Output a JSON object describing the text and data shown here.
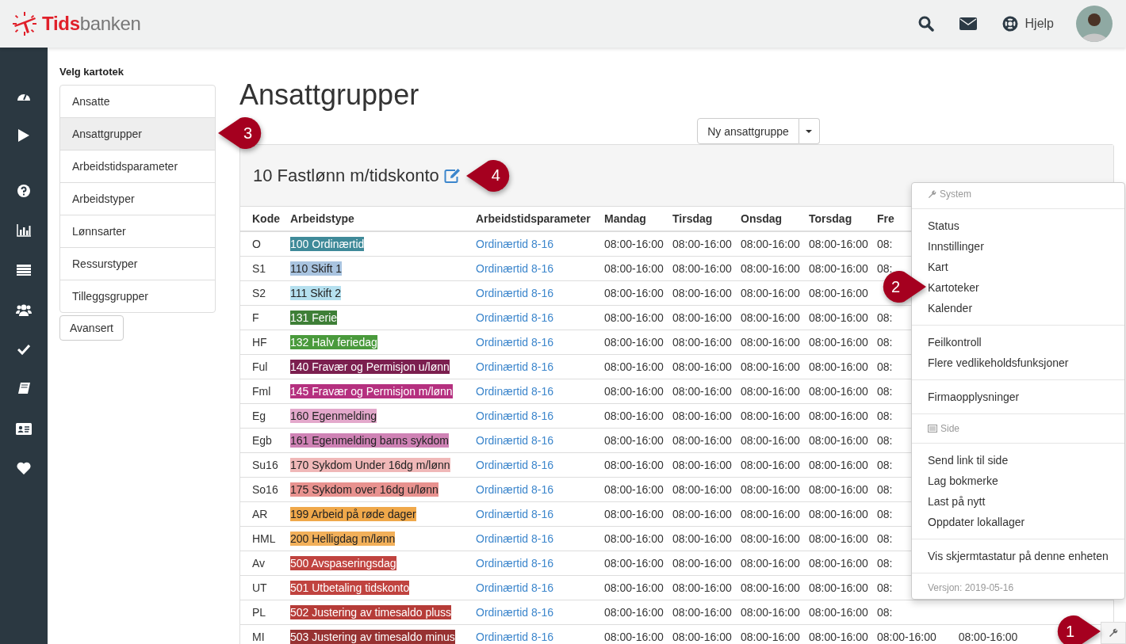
{
  "header": {
    "logo_red": "Tids",
    "logo_grey": "banken",
    "help": "Hjelp"
  },
  "sidebar": {
    "title": "Velg kartotek",
    "items": [
      {
        "label": "Ansatte",
        "selected": false
      },
      {
        "label": "Ansattgrupper",
        "selected": true,
        "callout": {
          "label": "3",
          "points_right": false
        }
      },
      {
        "label": "Arbeidstidsparameter",
        "selected": false
      },
      {
        "label": "Arbeidstyper",
        "selected": false
      },
      {
        "label": "Lønnsarter",
        "selected": false
      },
      {
        "label": "Ressurstyper",
        "selected": false
      },
      {
        "label": "Tilleggsgrupper",
        "selected": false
      }
    ],
    "advanced_button": "Avansert"
  },
  "page_title": "Ansattgrupper",
  "new_button": "Ny ansattgruppe",
  "group": {
    "title": "10 Fastlønn m/tidskonto",
    "callout": {
      "label": "4",
      "points_right": false
    }
  },
  "table": {
    "columns": [
      "Kode",
      "Arbeidstype",
      "Arbeidstidsparameter",
      "Mandag",
      "Tirsdag",
      "Onsdag",
      "Torsdag",
      "Fre"
    ],
    "rows": [
      {
        "code": "O",
        "type": "100 Ordinærtid",
        "color": "#3f8a99",
        "param": "Ordinærtid 8-16",
        "times": [
          "08:00-16:00",
          "08:00-16:00",
          "08:00-16:00",
          "08:00-16:00",
          "08:"
        ]
      },
      {
        "code": "S1",
        "type": "110 Skift 1",
        "color": "#a9c4e0",
        "param": "Ordinærtid 8-16",
        "times": [
          "08:00-16:00",
          "08:00-16:00",
          "08:00-16:00",
          "08:00-16:00",
          "08:"
        ]
      },
      {
        "code": "S2",
        "type": "111 Skift 2",
        "color": "#b5e0ef",
        "param": "Ordinærtid 8-16",
        "times": [
          "08:00-16:00",
          "08:00-16:00",
          "08:00-16:00",
          "08:00-16:00"
        ]
      },
      {
        "code": "F",
        "type": "131 Ferie",
        "color": "#3e7f37",
        "param": "Ordinærtid 8-16",
        "times": [
          "08:00-16:00",
          "08:00-16:00",
          "08:00-16:00",
          "08:00-16:00",
          "08:"
        ]
      },
      {
        "code": "HF",
        "type": "132 Halv feriedag",
        "color": "#4a9a3c",
        "param": "Ordinærtid 8-16",
        "times": [
          "08:00-16:00",
          "08:00-16:00",
          "08:00-16:00",
          "08:00-16:00",
          "08:"
        ]
      },
      {
        "code": "Ful",
        "type": "140 Fravær og Permisjon u/lønn",
        "color": "#7b1f4f",
        "param": "Ordinærtid 8-16",
        "times": [
          "08:00-16:00",
          "08:00-16:00",
          "08:00-16:00",
          "08:00-16:00",
          "08:"
        ]
      },
      {
        "code": "Fml",
        "type": "145 Fravær og Permisjon m/lønn",
        "color": "#b5307f",
        "param": "Ordinærtid 8-16",
        "times": [
          "08:00-16:00",
          "08:00-16:00",
          "08:00-16:00",
          "08:00-16:00",
          "08:"
        ]
      },
      {
        "code": "Eg",
        "type": "160 Egenmelding",
        "color": "#e3a8cb",
        "param": "Ordinærtid 8-16",
        "times": [
          "08:00-16:00",
          "08:00-16:00",
          "08:00-16:00",
          "08:00-16:00",
          "08:"
        ]
      },
      {
        "code": "Egb",
        "type": "161 Egenmelding barns sykdom",
        "color": "#cf82b5",
        "param": "Ordinærtid 8-16",
        "times": [
          "08:00-16:00",
          "08:00-16:00",
          "08:00-16:00",
          "08:00-16:00",
          "08:"
        ]
      },
      {
        "code": "Su16",
        "type": "170 Sykdom Under 16dg m/lønn",
        "color": "#f0b8b8",
        "param": "Ordinærtid 8-16",
        "times": [
          "08:00-16:00",
          "08:00-16:00",
          "08:00-16:00",
          "08:00-16:00",
          "08:"
        ]
      },
      {
        "code": "So16",
        "type": "175 Sykdom over 16dg u/lønn",
        "color": "#e8928f",
        "param": "Ordinærtid 8-16",
        "times": [
          "08:00-16:00",
          "08:00-16:00",
          "08:00-16:00",
          "08:00-16:00",
          "08:"
        ]
      },
      {
        "code": "AR",
        "type": "199 Arbeid på røde dager",
        "color": "#f0a84a",
        "param": "Ordinærtid 8-16",
        "times": [
          "08:00-16:00",
          "08:00-16:00",
          "08:00-16:00",
          "08:00-16:00",
          "08:"
        ]
      },
      {
        "code": "HML",
        "type": "200 Helligdag m/lønn",
        "color": "#f2b05a",
        "param": "Ordinærtid 8-16",
        "times": [
          "08:00-16:00",
          "08:00-16:00",
          "08:00-16:00",
          "08:00-16:00",
          "08:"
        ]
      },
      {
        "code": "Av",
        "type": "500 Avspaseringsdag",
        "color": "#c0433f",
        "param": "Ordinærtid 8-16",
        "times": [
          "08:00-16:00",
          "08:00-16:00",
          "08:00-16:00",
          "08:00-16:00",
          "08:"
        ]
      },
      {
        "code": "UT",
        "type": "501 Utbetaling tidskonto",
        "color": "#c0433f",
        "param": "Ordinærtid 8-16",
        "times": [
          "08:00-16:00",
          "08:00-16:00",
          "08:00-16:00",
          "08:00-16:00",
          "08:"
        ]
      },
      {
        "code": "PL",
        "type": "502 Justering av timesaldo pluss",
        "color": "#b63c38",
        "param": "Ordinærtid 8-16",
        "times": [
          "08:00-16:00",
          "08:00-16:00",
          "08:00-16:00",
          "08:00-16:00",
          "08:"
        ]
      },
      {
        "code": "MI",
        "type": "503 Justering av timesaldo minus",
        "color": "#973232",
        "param": "Ordinærtid 8-16",
        "times": [
          "08:00-16:00",
          "08:00-16:00",
          "08:00-16:00",
          "08:00-16:00",
          "08:00-16:00",
          "08:00-16:00"
        ]
      }
    ]
  },
  "menu": {
    "groups": [
      {
        "entries": [
          {
            "kind": "header",
            "label": "System"
          }
        ]
      },
      {
        "entries": [
          {
            "kind": "item",
            "label": "Status"
          },
          {
            "kind": "item",
            "label": "Innstillinger"
          },
          {
            "kind": "item",
            "label": "Kart"
          },
          {
            "kind": "item",
            "label": "Kartoteker",
            "callout": {
              "label": "2",
              "points_right": true
            }
          },
          {
            "kind": "item",
            "label": "Kalender"
          }
        ]
      },
      {
        "entries": [
          {
            "kind": "item",
            "label": "Feilkontroll"
          },
          {
            "kind": "item",
            "label": "Flere vedlikeholdsfunksjoner"
          }
        ]
      },
      {
        "entries": [
          {
            "kind": "item",
            "label": "Firmaopplysninger"
          }
        ]
      },
      {
        "entries": [
          {
            "kind": "header",
            "label": "Side"
          }
        ]
      },
      {
        "entries": [
          {
            "kind": "item",
            "label": "Send link til side"
          },
          {
            "kind": "item",
            "label": "Lag bokmerke"
          },
          {
            "kind": "item",
            "label": "Last på nytt"
          },
          {
            "kind": "item",
            "label": "Oppdater lokallager"
          }
        ]
      },
      {
        "entries": [
          {
            "kind": "item",
            "label": "Vis skjermtastatur på denne enheten"
          }
        ]
      },
      {
        "entries": [
          {
            "kind": "footer",
            "label": "Versjon: 2019-05-16"
          }
        ]
      }
    ]
  },
  "tools_button": {
    "callout": {
      "label": "1",
      "points_right": true
    }
  }
}
